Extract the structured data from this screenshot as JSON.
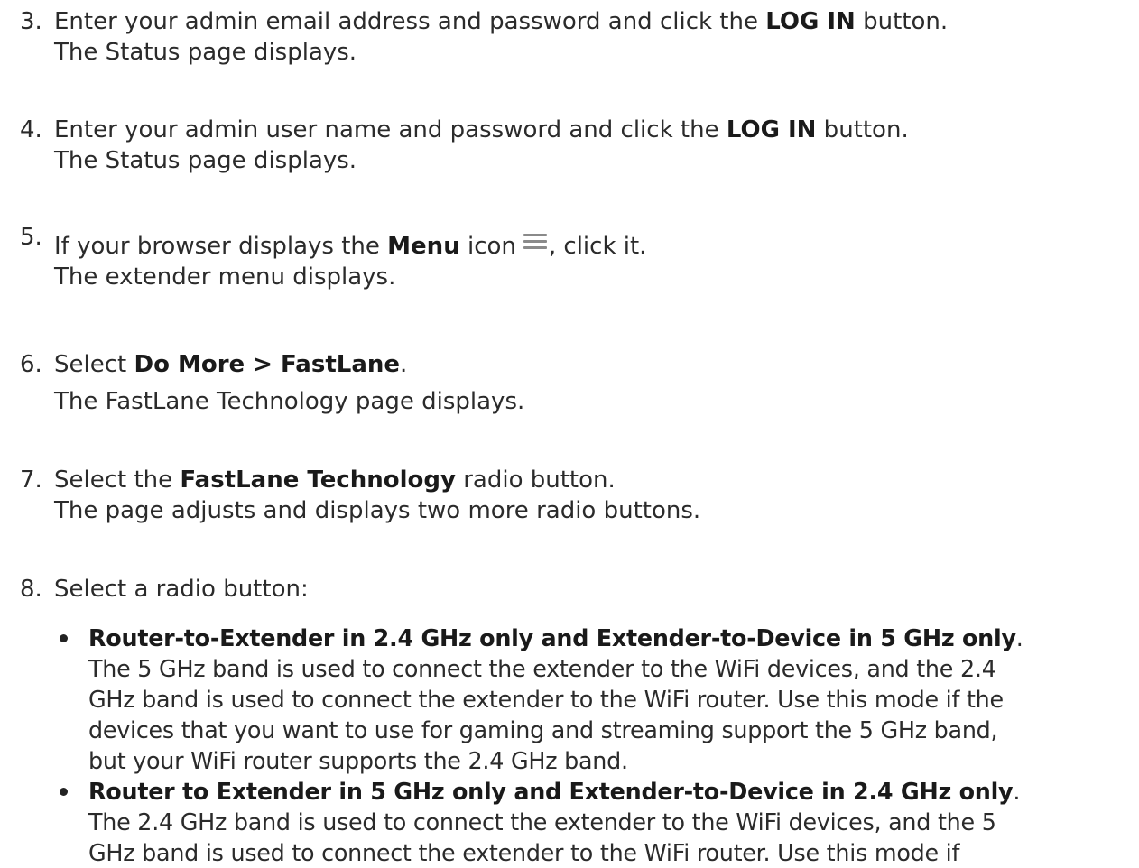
{
  "steps": [
    {
      "number": "3.",
      "lines": [
        [
          "Enter your admin email address and password and click the ",
          "LOG IN",
          " button."
        ],
        [
          "The Status page displays."
        ]
      ]
    },
    {
      "number": "4.",
      "lines": [
        [
          "Enter your admin user name and password and click the ",
          "LOG IN",
          " button."
        ],
        [
          "The Status page displays."
        ]
      ]
    },
    {
      "number": "5.",
      "line1_pre": "If your browser displays the ",
      "line1_bold": "Menu",
      "line1_mid": " icon",
      "line1_post": ", click it.",
      "line2": "The extender menu displays.",
      "icon": "hamburger-menu-icon"
    },
    {
      "number": "6.",
      "lines": [
        [
          "Select ",
          "Do More > FastLane",
          "."
        ],
        [
          "The FastLane Technology page displays."
        ]
      ]
    },
    {
      "number": "7.",
      "lines": [
        [
          "Select the ",
          "FastLane Technology",
          " radio button."
        ],
        [
          "The page adjusts and displays two more radio buttons."
        ]
      ]
    },
    {
      "number": "8.",
      "lines": [
        [
          "Select a radio button:"
        ]
      ]
    }
  ],
  "bullets": [
    {
      "title": "Router-to-Extender in 2.4 GHz only and Extender-to-Device in 5 GHz only",
      "title_end": ".",
      "body": [
        "The 5 GHz band is used to connect the extender to the WiFi devices, and the 2.4",
        "GHz band is used to connect the extender to the WiFi router. Use this mode if the",
        "devices that you want to use for gaming and streaming support the 5 GHz band,",
        "but your WiFi router supports the 2.4 GHz band."
      ]
    },
    {
      "title": "Router to Extender in 5 GHz only and Extender-to-Device in 2.4 GHz only",
      "title_end": ".",
      "body": [
        "The 2.4 GHz band is used to connect the extender to the WiFi devices, and the 5",
        "GHz band is used to connect the extender to the WiFi router. Use this mode if"
      ]
    }
  ]
}
